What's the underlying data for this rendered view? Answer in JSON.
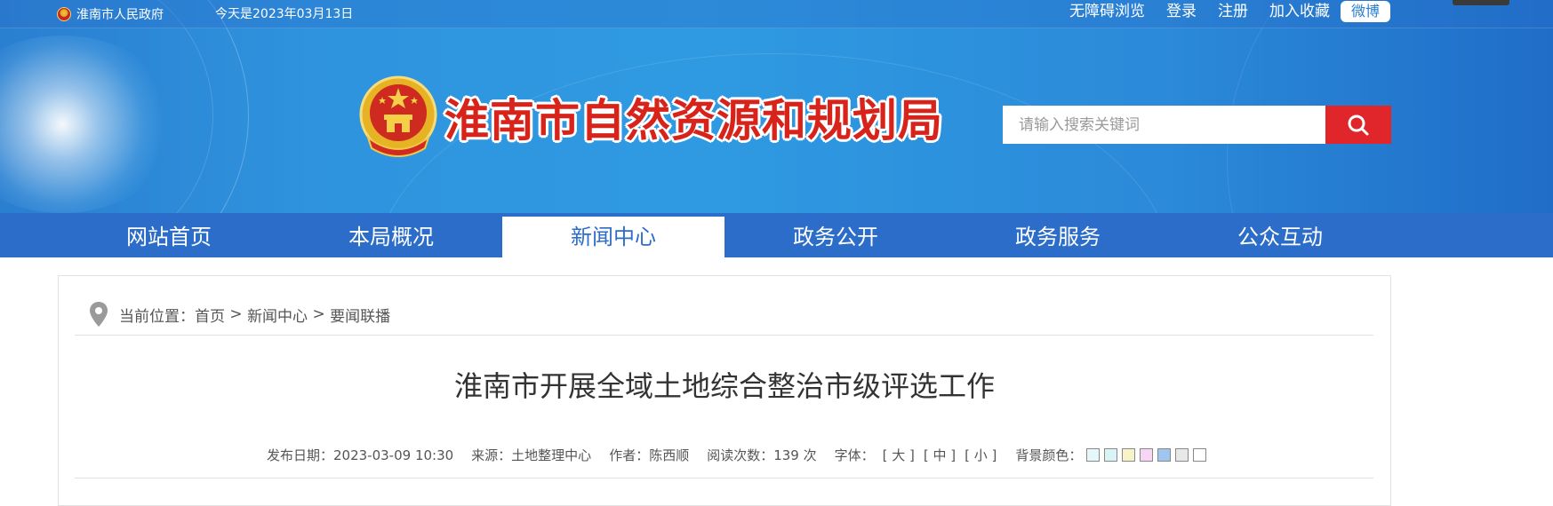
{
  "topbar": {
    "gov_link": "淮南市人民政府",
    "date_text": "今天是2023年03月13日",
    "links": [
      "无障碍浏览",
      "登录",
      "注册",
      "加入收藏"
    ],
    "weibo": "微博"
  },
  "header": {
    "site_title": "淮南市自然资源和规划局",
    "emblem_icon": "national-emblem-icon",
    "search_placeholder": "请输入搜索关键词",
    "search_icon": "search-icon"
  },
  "nav": {
    "items": [
      "网站首页",
      "本局概况",
      "新闻中心",
      "政务公开",
      "政务服务",
      "公众互动"
    ],
    "active_index": 2
  },
  "breadcrumb": {
    "prefix": "当前位置：",
    "home": "首页",
    "sep": " > ",
    "section": "新闻中心",
    "current": "要闻联播"
  },
  "article": {
    "title": "淮南市开展全域土地综合整治市级评选工作",
    "publish_date": "发布日期：2023-03-09 10:30",
    "source": "来源：土地整理中心",
    "author": "作者：陈西顺",
    "read_count": "阅读次数：139 次",
    "font_label": "字体：",
    "font_large": "[ 大 ]",
    "font_medium": "[ 中 ]",
    "font_small": "[ 小 ]",
    "bg_label": "背景颜色：",
    "bg_colors": [
      "#e6f7f7",
      "#d8f4f4",
      "#f7f2c8",
      "#f6d6f3",
      "#9ec6ee",
      "#e8e8e8",
      "#ffffff"
    ]
  },
  "colors": {
    "brand_red": "#d8231b",
    "nav_blue": "#2b6dc8",
    "search_red": "#e0262a"
  }
}
